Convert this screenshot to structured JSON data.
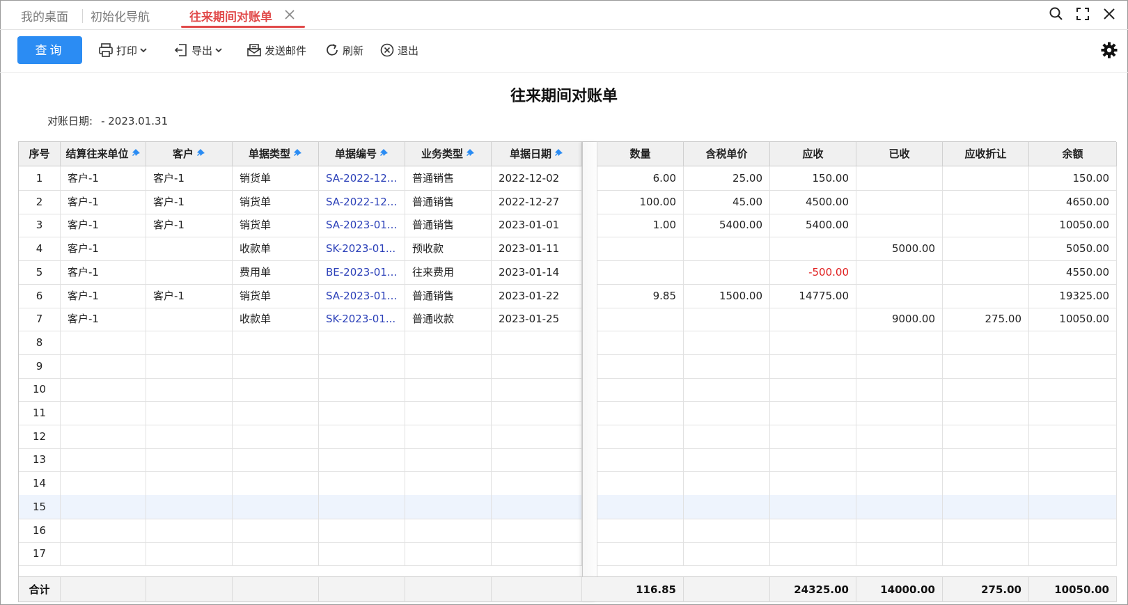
{
  "tabs": {
    "desktop": "我的桌面",
    "init_nav": "初始化导航",
    "active": "往来期间对账单"
  },
  "toolbar": {
    "query": "查询",
    "print": "打印",
    "export": "导出",
    "send_mail": "发送邮件",
    "refresh": "刷新",
    "exit": "退出"
  },
  "report": {
    "title": "往来期间对账单",
    "date_label": "对账日期:",
    "date_value": "- 2023.01.31"
  },
  "columns": {
    "seq": "序号",
    "partner": "结算往来单位",
    "customer": "客户",
    "doc_type": "单据类型",
    "doc_no": "单据编号",
    "biz_type": "业务类型",
    "doc_date": "单据日期",
    "qty": "数量",
    "unit_price": "含税单价",
    "receivable": "应收",
    "received": "已收",
    "discount": "应收折让",
    "balance": "余额"
  },
  "rows": [
    {
      "seq": "1",
      "partner": "客户-1",
      "customer": "客户-1",
      "doc_type": "销货单",
      "doc_no": "SA-2022-12...",
      "biz_type": "普通销售",
      "doc_date": "2022-12-02",
      "qty": "6.00",
      "unit_price": "25.00",
      "receivable": "150.00",
      "received": "",
      "discount": "",
      "balance": "150.00"
    },
    {
      "seq": "2",
      "partner": "客户-1",
      "customer": "客户-1",
      "doc_type": "销货单",
      "doc_no": "SA-2022-12...",
      "biz_type": "普通销售",
      "doc_date": "2022-12-27",
      "qty": "100.00",
      "unit_price": "45.00",
      "receivable": "4500.00",
      "received": "",
      "discount": "",
      "balance": "4650.00"
    },
    {
      "seq": "3",
      "partner": "客户-1",
      "customer": "客户-1",
      "doc_type": "销货单",
      "doc_no": "SA-2023-01...",
      "biz_type": "普通销售",
      "doc_date": "2023-01-01",
      "qty": "1.00",
      "unit_price": "5400.00",
      "receivable": "5400.00",
      "received": "",
      "discount": "",
      "balance": "10050.00"
    },
    {
      "seq": "4",
      "partner": "客户-1",
      "customer": "",
      "doc_type": "收款单",
      "doc_no": "SK-2023-01...",
      "biz_type": "预收款",
      "doc_date": "2023-01-11",
      "qty": "",
      "unit_price": "",
      "receivable": "",
      "received": "5000.00",
      "discount": "",
      "balance": "5050.00"
    },
    {
      "seq": "5",
      "partner": "客户-1",
      "customer": "",
      "doc_type": "费用单",
      "doc_no": "BE-2023-01...",
      "biz_type": "往来费用",
      "doc_date": "2023-01-14",
      "qty": "",
      "unit_price": "",
      "receivable": "-500.00",
      "received": "",
      "discount": "",
      "balance": "4550.00"
    },
    {
      "seq": "6",
      "partner": "客户-1",
      "customer": "客户-1",
      "doc_type": "销货单",
      "doc_no": "SA-2023-01...",
      "biz_type": "普通销售",
      "doc_date": "2023-01-22",
      "qty": "9.85",
      "unit_price": "1500.00",
      "receivable": "14775.00",
      "received": "",
      "discount": "",
      "balance": "19325.00"
    },
    {
      "seq": "7",
      "partner": "客户-1",
      "customer": "",
      "doc_type": "收款单",
      "doc_no": "SK-2023-01...",
      "biz_type": "普通收款",
      "doc_date": "2023-01-25",
      "qty": "",
      "unit_price": "",
      "receivable": "",
      "received": "9000.00",
      "discount": "275.00",
      "balance": "10050.00"
    }
  ],
  "empty_rows": [
    "8",
    "9",
    "10",
    "11",
    "12",
    "13",
    "14",
    "15",
    "16",
    "17"
  ],
  "totals": {
    "label": "合计",
    "qty": "116.85",
    "receivable": "24325.00",
    "received": "14000.00",
    "discount": "275.00",
    "balance": "10050.00"
  },
  "colors": {
    "accent": "#2b8cf3",
    "active_tab": "#e14b4b",
    "link": "#2a3fb8",
    "negative": "#e02020"
  }
}
